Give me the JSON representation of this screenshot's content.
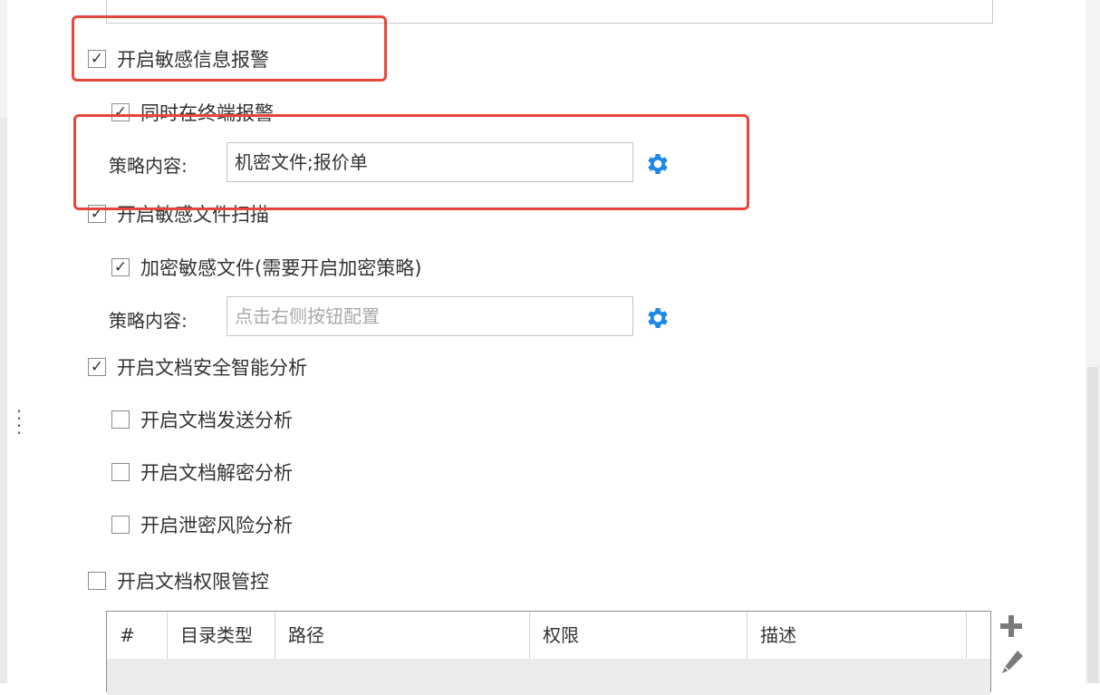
{
  "options": {
    "sensitive_alert": {
      "label": "开启敏感信息报警",
      "checked": true
    },
    "terminal_alert": {
      "label": "同时在终端报警",
      "checked": true
    },
    "alert_policy": {
      "label": "策略内容:",
      "value": "机密文件;报价单",
      "placeholder": ""
    },
    "sensitive_scan": {
      "label": "开启敏感文件扫描",
      "checked": true
    },
    "encrypt_sensitive": {
      "label": "加密敏感文件(需要开启加密策略)",
      "checked": true
    },
    "scan_policy": {
      "label": "策略内容:",
      "value": "",
      "placeholder": "点击右侧按钮配置"
    },
    "doc_analysis": {
      "label": "开启文档安全智能分析",
      "checked": true
    },
    "send_analysis": {
      "label": "开启文档发送分析",
      "checked": false
    },
    "decrypt_analysis": {
      "label": "开启文档解密分析",
      "checked": false
    },
    "leak_analysis": {
      "label": "开启泄密风险分析",
      "checked": false
    },
    "permission_control": {
      "label": "开启文档权限管控",
      "checked": false
    }
  },
  "check_glyph": "✓",
  "table": {
    "columns": [
      "#",
      "目录类型",
      "路径",
      "权限",
      "描述"
    ]
  },
  "colors": {
    "accent": "#1e88e5",
    "highlight": "#e8453c"
  },
  "icons": {
    "gear": "gear-icon",
    "add": "plus-icon",
    "edit": "pencil-icon"
  }
}
